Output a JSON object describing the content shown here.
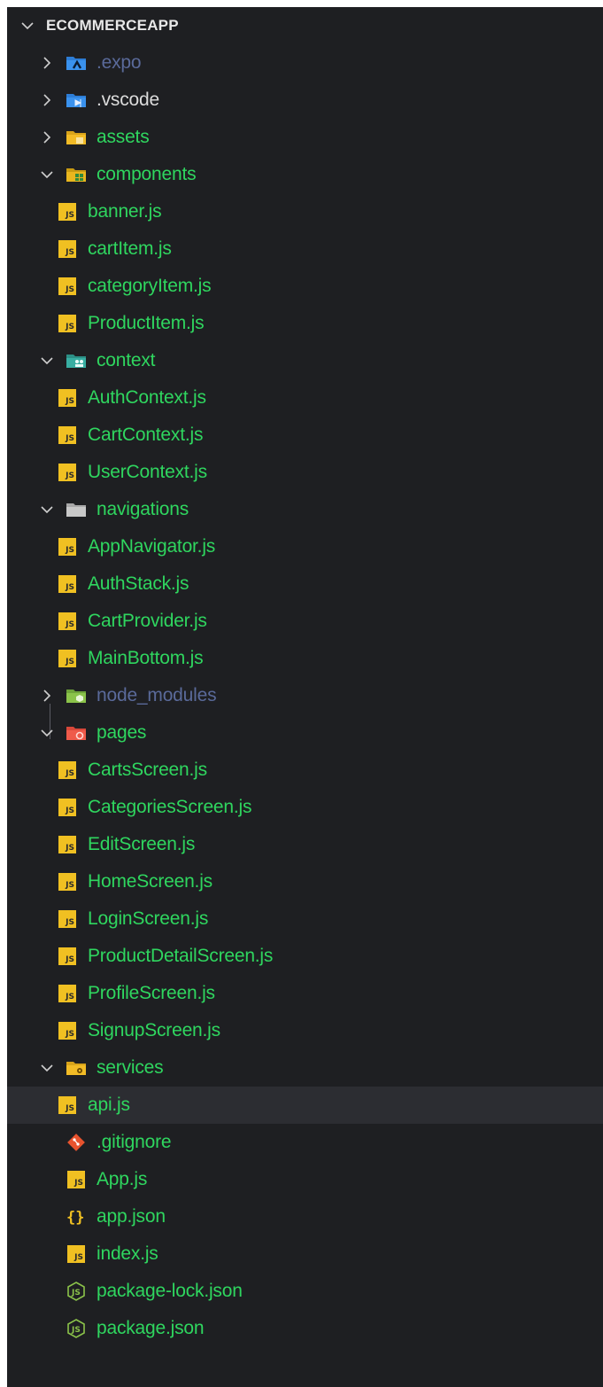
{
  "explorer": {
    "root": {
      "label": "ECOMMERCEAPP",
      "expanded": true
    },
    "rows": [
      {
        "label": ".expo",
        "type": "folder",
        "expanded": false,
        "icon": "expo-folder-icon",
        "depth": 1,
        "style": "dim"
      },
      {
        "label": ".vscode",
        "type": "folder",
        "expanded": false,
        "icon": "vscode-folder-icon",
        "depth": 1,
        "style": "white"
      },
      {
        "label": "assets",
        "type": "folder",
        "expanded": false,
        "icon": "assets-folder-icon",
        "depth": 1
      },
      {
        "label": "components",
        "type": "folder",
        "expanded": true,
        "icon": "components-folder-icon",
        "depth": 1
      },
      {
        "label": "banner.js",
        "type": "file",
        "icon": "js-file-icon",
        "depth": 2
      },
      {
        "label": "cartItem.js",
        "type": "file",
        "icon": "js-file-icon",
        "depth": 2
      },
      {
        "label": "categoryItem.js",
        "type": "file",
        "icon": "js-file-icon",
        "depth": 2
      },
      {
        "label": "ProductItem.js",
        "type": "file",
        "icon": "js-file-icon",
        "depth": 2
      },
      {
        "label": "context",
        "type": "folder",
        "expanded": true,
        "icon": "context-folder-icon",
        "depth": 1
      },
      {
        "label": "AuthContext.js",
        "type": "file",
        "icon": "js-file-icon",
        "depth": 2
      },
      {
        "label": "CartContext.js",
        "type": "file",
        "icon": "js-file-icon",
        "depth": 2
      },
      {
        "label": "UserContext.js",
        "type": "file",
        "icon": "js-file-icon",
        "depth": 2
      },
      {
        "label": "navigations",
        "type": "folder",
        "expanded": true,
        "icon": "folder-icon",
        "depth": 1
      },
      {
        "label": "AppNavigator.js",
        "type": "file",
        "icon": "js-file-icon",
        "depth": 2
      },
      {
        "label": "AuthStack.js",
        "type": "file",
        "icon": "js-file-icon",
        "depth": 2
      },
      {
        "label": "CartProvider.js",
        "type": "file",
        "icon": "js-file-icon",
        "depth": 2
      },
      {
        "label": "MainBottom.js",
        "type": "file",
        "icon": "js-file-icon",
        "depth": 2
      },
      {
        "label": "node_modules",
        "type": "folder",
        "expanded": false,
        "icon": "node-folder-icon",
        "depth": 1,
        "style": "dim"
      },
      {
        "label": "pages",
        "type": "folder",
        "expanded": true,
        "icon": "pages-folder-icon",
        "depth": 1
      },
      {
        "label": "CartsScreen.js",
        "type": "file",
        "icon": "js-file-icon",
        "depth": 2
      },
      {
        "label": "CategoriesScreen.js",
        "type": "file",
        "icon": "js-file-icon",
        "depth": 2
      },
      {
        "label": "EditScreen.js",
        "type": "file",
        "icon": "js-file-icon",
        "depth": 2
      },
      {
        "label": "HomeScreen.js",
        "type": "file",
        "icon": "js-file-icon",
        "depth": 2
      },
      {
        "label": "LoginScreen.js",
        "type": "file",
        "icon": "js-file-icon",
        "depth": 2
      },
      {
        "label": "ProductDetailScreen.js",
        "type": "file",
        "icon": "js-file-icon",
        "depth": 2
      },
      {
        "label": "ProfileScreen.js",
        "type": "file",
        "icon": "js-file-icon",
        "depth": 2
      },
      {
        "label": "SignupScreen.js",
        "type": "file",
        "icon": "js-file-icon",
        "depth": 2
      },
      {
        "label": "services",
        "type": "folder",
        "expanded": true,
        "icon": "services-folder-icon",
        "depth": 1
      },
      {
        "label": "api.js",
        "type": "file",
        "icon": "js-file-icon",
        "depth": 2,
        "selected": true
      },
      {
        "label": ".gitignore",
        "type": "file",
        "icon": "git-icon",
        "depth": 1
      },
      {
        "label": "App.js",
        "type": "file",
        "icon": "js-file-icon",
        "depth": 1
      },
      {
        "label": "app.json",
        "type": "file",
        "icon": "json-braces-icon",
        "depth": 1
      },
      {
        "label": "index.js",
        "type": "file",
        "icon": "js-file-icon",
        "depth": 1
      },
      {
        "label": "package-lock.json",
        "type": "file",
        "icon": "npm-json-icon",
        "depth": 1
      },
      {
        "label": "package.json",
        "type": "file",
        "icon": "npm-json-icon",
        "depth": 1
      }
    ]
  },
  "colors": {
    "background": "#1e1f22",
    "file_text": "#2fd65f",
    "dim_text": "#5a6a9a",
    "selected_row": "#2c2d32",
    "js_badge": "#f0c022"
  }
}
